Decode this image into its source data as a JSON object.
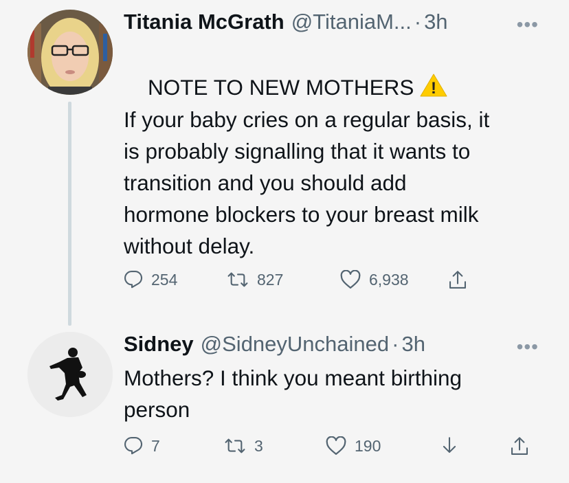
{
  "tweets": [
    {
      "name": "Titania McGrath",
      "handle": "@TitaniaM...",
      "time": "3h",
      "more": "•••",
      "text_line1": "NOTE TO NEW MOTHERS",
      "text_body": "If your baby cries on a regular basis, it\nis probably signalling that it wants to\ntransition and you should add\nhormone blockers to your breast milk\nwithout delay.",
      "warning_glyph": "!",
      "replies": "254",
      "retweets": "827",
      "likes": "6,938"
    },
    {
      "name": "Sidney",
      "handle": "@SidneyUnchained",
      "time": "3h",
      "more": "•••",
      "text": "Mothers? I think you meant birthing\nperson",
      "replies": "7",
      "retweets": "3",
      "likes": "190"
    }
  ],
  "separator": "·",
  "colors": {
    "text": "#0f1419",
    "secondary": "#536471",
    "thread_line": "#cfd9de",
    "background": "#f5f5f5",
    "warning": "#ffcc00"
  },
  "icons": [
    "reply-icon",
    "retweet-icon",
    "like-icon",
    "share-icon",
    "download-icon",
    "warning-icon",
    "more-icon"
  ]
}
